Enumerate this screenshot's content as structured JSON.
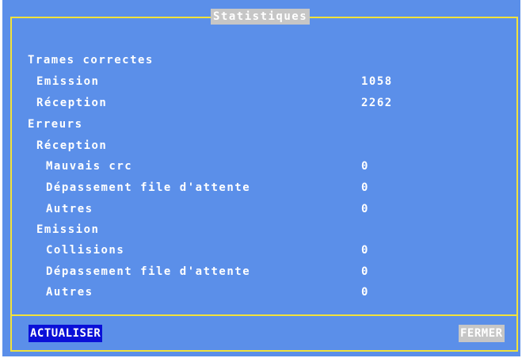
{
  "window": {
    "title": "Statistiques"
  },
  "stats": {
    "trames_correctes": {
      "label": "Trames correctes",
      "emission": {
        "label": "Emission",
        "value": "1058"
      },
      "reception": {
        "label": "Réception",
        "value": "2262"
      }
    },
    "erreurs": {
      "label": "Erreurs",
      "reception": {
        "label": "Réception",
        "mauvais_crc": {
          "label": "Mauvais crc",
          "value": "0"
        },
        "depassement": {
          "label": "Dépassement file d'attente",
          "value": "0"
        },
        "autres": {
          "label": "Autres",
          "value": "0"
        }
      },
      "emission": {
        "label": "Emission",
        "collisions": {
          "label": "Collisions",
          "value": "0"
        },
        "depassement": {
          "label": "Dépassement file d'attente",
          "value": "0"
        },
        "autres": {
          "label": "Autres",
          "value": "0"
        }
      }
    }
  },
  "buttons": {
    "actualiser": "ACTUALISER",
    "fermer": "FERMER"
  },
  "colors": {
    "background": "#5b8fe9",
    "frame": "#f2e23a",
    "text": "#ffffff",
    "selected_button": "#0a10d8",
    "disabled_button": "#c6c6c6"
  }
}
